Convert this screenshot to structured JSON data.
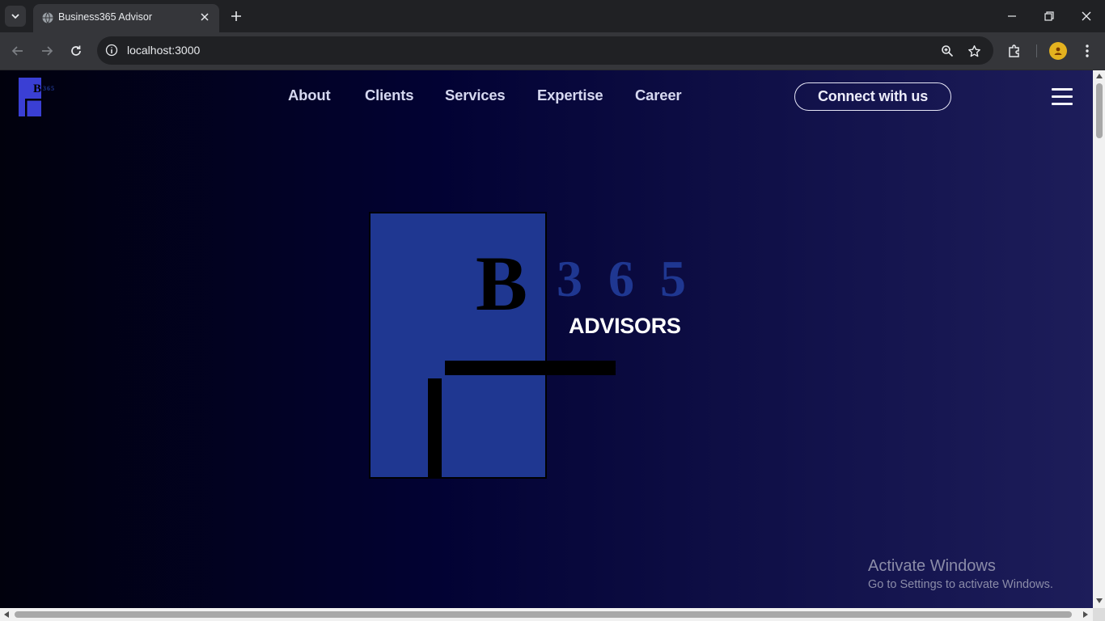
{
  "browser": {
    "tab_title": "Business365 Advisor",
    "url": "localhost:3000"
  },
  "site": {
    "nav": [
      "About",
      "Clients",
      "Services",
      "Expertise",
      "Career"
    ],
    "cta_label": "Connect with us",
    "logo": {
      "letter": "B",
      "digits": "3 6 5",
      "tagline": "ADVISORS"
    }
  },
  "watermark": {
    "title": "Activate Windows",
    "subtitle": "Go to Settings to activate Windows."
  },
  "colors": {
    "logo_blue": "#1f3791",
    "nav_logo_blue": "#3a3fd4"
  },
  "icons": [
    "chevron-down-icon",
    "globe-icon",
    "close-icon",
    "plus-icon",
    "minimize-icon",
    "restore-icon",
    "back-arrow-icon",
    "forward-arrow-icon",
    "reload-icon",
    "site-info-icon",
    "zoom-icon",
    "star-icon",
    "extensions-icon",
    "menu-kebab-icon",
    "hamburger-icon"
  ]
}
